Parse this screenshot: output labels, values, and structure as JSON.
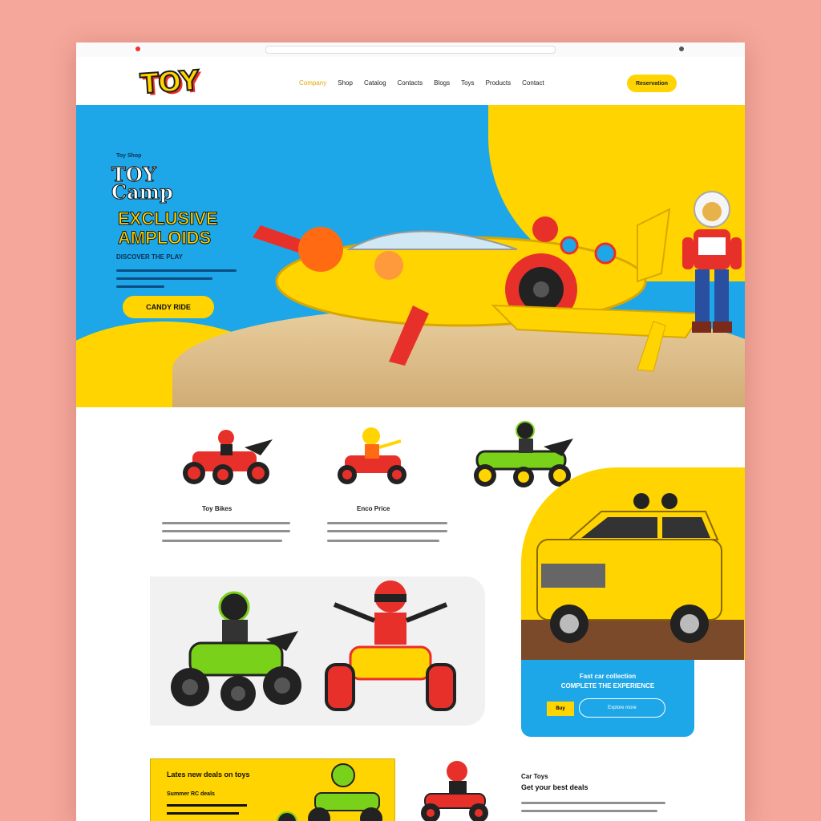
{
  "utility_bar": {
    "left_text": "",
    "right_text": ""
  },
  "header": {
    "logo": "TOY",
    "nav": [
      "Company",
      "Shop",
      "Catalog",
      "Contacts",
      "Blogs",
      "Toys",
      "Products",
      "Contact"
    ],
    "cta": "Reservation"
  },
  "hero": {
    "kicker": "Toy Shop",
    "title_line1": "TOY",
    "title_line2": "Camp",
    "title_line3": "EXCLUSIVE",
    "title_line4": "AMPLOIDS",
    "subtitle": "DISCOVER THE PLAY",
    "cta": "CANDY RIDE"
  },
  "products": [
    {
      "title": "Toy Bikes"
    },
    {
      "title": "Enco Price"
    }
  ],
  "suv_card": {
    "line1": "Fast car collection",
    "line2": "COMPLETE THE EXPERIENCE",
    "tag": "Buy",
    "button": "Explore more"
  },
  "promo": {
    "title": "Lates new deals on toys",
    "subtitle": "Summer RC deals"
  },
  "bottom_right": {
    "title1": "Car Toys",
    "title2": "Get your best deals"
  },
  "colors": {
    "accent_yellow": "#ffd400",
    "accent_blue": "#1ea7e8",
    "background": "#f4a79a"
  }
}
